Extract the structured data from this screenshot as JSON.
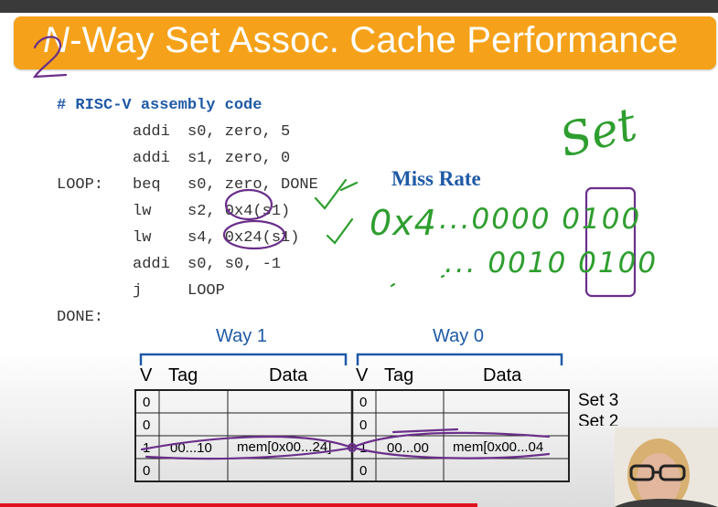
{
  "title": {
    "prefix_n": "N",
    "rest": "-Way Set Assoc. Cache Performance"
  },
  "code": {
    "comment": "# RISC-V assembly code",
    "lines": [
      {
        "label": "",
        "op": "addi",
        "args": "s0, zero, 5"
      },
      {
        "label": "",
        "op": "addi",
        "args": "s1, zero, 0"
      },
      {
        "label": "LOOP:",
        "op": "beq",
        "args": "s0, zero, DONE"
      },
      {
        "label": "",
        "op": "lw",
        "args": "s2, 0x4(s1)"
      },
      {
        "label": "",
        "op": "lw",
        "args": "s4, 0x24(s1)"
      },
      {
        "label": "",
        "op": "addi",
        "args": "s0, s0, -1"
      },
      {
        "label": "",
        "op": "j",
        "args": "LOOP"
      },
      {
        "label": "DONE:",
        "op": "",
        "args": ""
      }
    ]
  },
  "miss_rate_label": "Miss Rate",
  "handwriting": {
    "set_word": "Set",
    "two": "2",
    "line1_prefix": "0x4",
    "line1_bits": "...0000 0100",
    "line2_bits": "... 0010 0100"
  },
  "cache": {
    "way1_label": "Way 1",
    "way0_label": "Way 0",
    "headers": {
      "v": "V",
      "tag": "Tag",
      "data": "Data"
    },
    "way1_rows": [
      {
        "v": "0",
        "tag": "",
        "data": ""
      },
      {
        "v": "0",
        "tag": "",
        "data": ""
      },
      {
        "v": "1",
        "tag": "00...10",
        "data": "mem[0x00...24]"
      },
      {
        "v": "0",
        "tag": "",
        "data": ""
      }
    ],
    "way0_rows": [
      {
        "v": "0",
        "tag": "",
        "data": ""
      },
      {
        "v": "0",
        "tag": "",
        "data": ""
      },
      {
        "v": "1",
        "tag": "00...00",
        "data": "mem[0x00...04"
      },
      {
        "v": "0",
        "tag": "",
        "data": ""
      }
    ],
    "set_labels": [
      "Set 3",
      "Set 2"
    ]
  },
  "colors": {
    "title_bar": "#f5a21a",
    "accent_blue": "#1f5aa6",
    "ink": "#6a2f8a",
    "ink_green": "#2e9e2e",
    "progress_red": "#e0141e"
  }
}
